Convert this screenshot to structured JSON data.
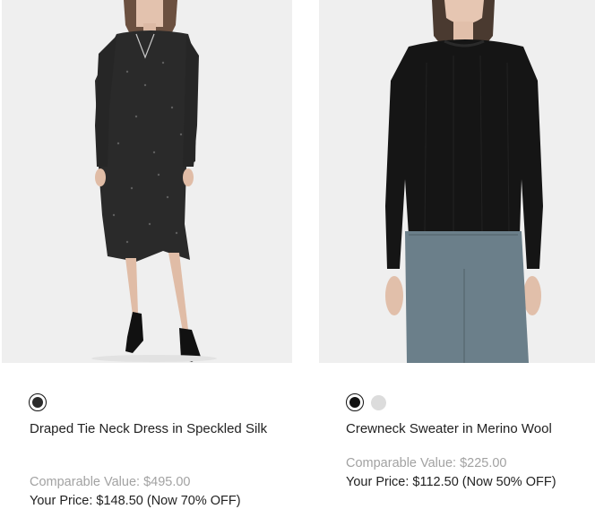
{
  "products": [
    {
      "name": "Draped Tie Neck Dress in Speckled Silk",
      "image_alt": "Model wearing speckled silk dress",
      "comparable_value": "Comparable Value: $495.00",
      "your_price": "Your Price: $148.50 (Now 70% OFF)",
      "swatches": [
        {
          "name": "Speckled Black",
          "color": "#2b2b2b",
          "selected": true
        }
      ]
    },
    {
      "name": "Crewneck Sweater in Merino Wool",
      "image_alt": "Model wearing black crewneck sweater",
      "comparable_value": "Comparable Value: $225.00",
      "your_price": "Your Price: $112.50 (Now 50% OFF)",
      "swatches": [
        {
          "name": "Black",
          "color": "#111111",
          "selected": true
        },
        {
          "name": "Light Grey",
          "color": "#dcdcdc",
          "selected": false
        }
      ]
    }
  ]
}
